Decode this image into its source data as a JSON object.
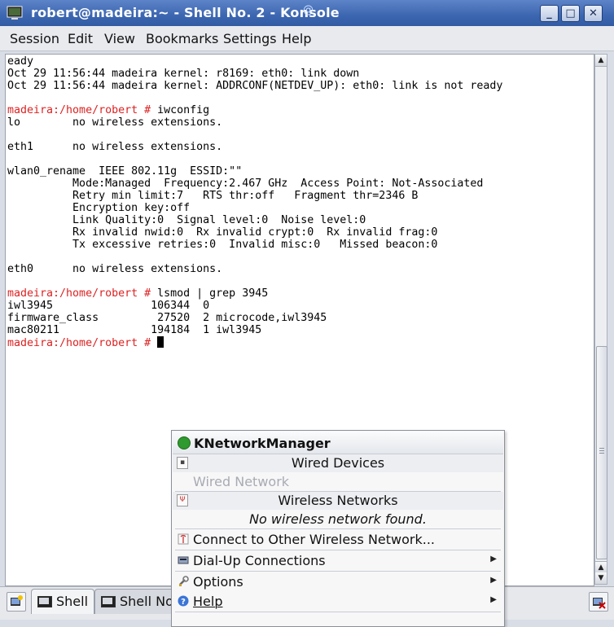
{
  "window": {
    "title": "robert@madeira:~ - Shell No. 2 - Konsole",
    "minimize": "_",
    "maximize": "□",
    "close": "✕"
  },
  "menubar": [
    "Session",
    "Edit",
    "View",
    "Bookmarks",
    "Settings",
    "Help"
  ],
  "terminal": {
    "lines": [
      {
        "t": "eady"
      },
      {
        "t": "Oct 29 11:56:44 madeira kernel: r8169: eth0: link down"
      },
      {
        "t": "Oct 29 11:56:44 madeira kernel: ADDRCONF(NETDEV_UP): eth0: link is not ready"
      },
      {
        "t": ""
      },
      {
        "p": "madeira:/home/robert # ",
        "t": "iwconfig"
      },
      {
        "t": "lo        no wireless extensions."
      },
      {
        "t": ""
      },
      {
        "t": "eth1      no wireless extensions."
      },
      {
        "t": ""
      },
      {
        "t": "wlan0_rename  IEEE 802.11g  ESSID:\"\""
      },
      {
        "t": "          Mode:Managed  Frequency:2.467 GHz  Access Point: Not-Associated"
      },
      {
        "t": "          Retry min limit:7   RTS thr:off   Fragment thr=2346 B"
      },
      {
        "t": "          Encryption key:off"
      },
      {
        "t": "          Link Quality:0  Signal level:0  Noise level:0"
      },
      {
        "t": "          Rx invalid nwid:0  Rx invalid crypt:0  Rx invalid frag:0"
      },
      {
        "t": "          Tx excessive retries:0  Invalid misc:0   Missed beacon:0"
      },
      {
        "t": ""
      },
      {
        "t": "eth0      no wireless extensions."
      },
      {
        "t": ""
      },
      {
        "p": "madeira:/home/robert # ",
        "t": "lsmod | grep 3945"
      },
      {
        "t": "iwl3945               106344  0"
      },
      {
        "t": "firmware_class         27520  2 microcode,iwl3945"
      },
      {
        "t": "mac80211              194184  1 iwl3945"
      },
      {
        "p": "madeira:/home/robert # ",
        "t": "",
        "cursor": true
      }
    ]
  },
  "tabs": [
    {
      "label": "Shell",
      "icon": "terminal-icon"
    },
    {
      "label": "Shell No.",
      "icon": "terminal-icon"
    }
  ],
  "knetworkmanager": {
    "title": "KNetworkManager",
    "wired_header": "Wired Devices",
    "wired_network": "Wired Network",
    "wireless_header": "Wireless Networks",
    "no_wireless": "No wireless network found.",
    "connect_other": "Connect to Other Wireless Network...",
    "dialup": "Dial-Up Connections",
    "options": "Options",
    "help": "Help"
  }
}
